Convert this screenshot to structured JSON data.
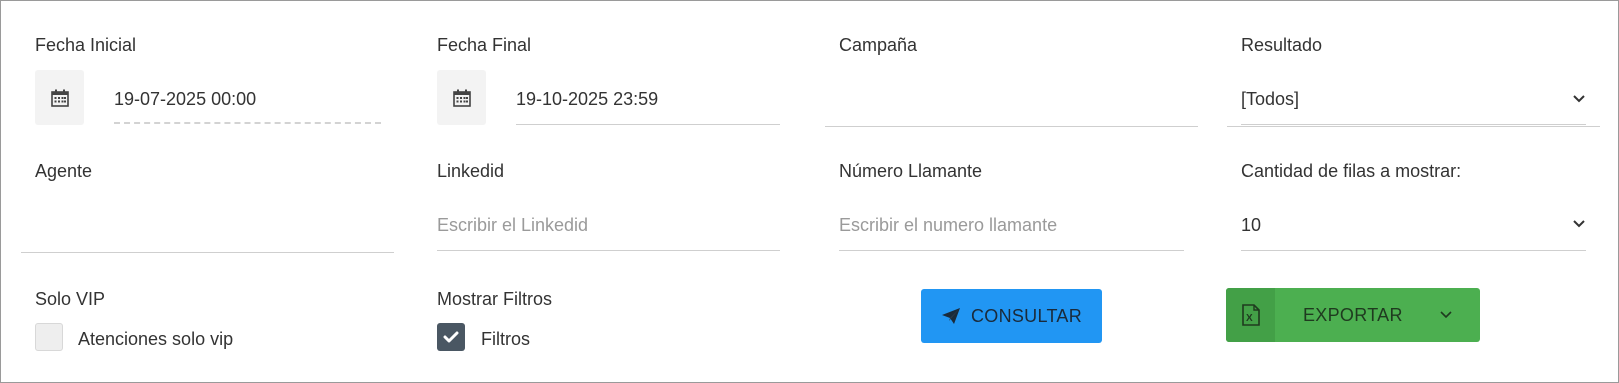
{
  "filters": {
    "fecha_inicial": {
      "label": "Fecha Inicial",
      "value": "19-07-2025 00:00"
    },
    "fecha_final": {
      "label": "Fecha Final",
      "value": "19-10-2025 23:59"
    },
    "campana": {
      "label": "Campaña",
      "value": ""
    },
    "resultado": {
      "label": "Resultado",
      "value": "[Todos]"
    },
    "agente": {
      "label": "Agente",
      "value": ""
    },
    "linkedid": {
      "label": "Linkedid",
      "placeholder": "Escribir el Linkedid"
    },
    "numero_llamante": {
      "label": "Número Llamante",
      "placeholder": "Escribir el numero llamante"
    },
    "cantidad_filas": {
      "label": "Cantidad de filas a mostrar:",
      "value": "10"
    },
    "solo_vip": {
      "label": "Solo VIP",
      "checkbox_label": "Atenciones solo vip",
      "checked": false
    },
    "mostrar_filtros": {
      "label": "Mostrar Filtros",
      "checkbox_label": "Filtros",
      "checked": true
    }
  },
  "actions": {
    "consultar_label": "CONSULTAR",
    "exportar_label": "EXPORTAR"
  },
  "icons": {
    "calendar": "calendar-icon",
    "chevron": "chevron-down-icon",
    "send": "paper-plane-icon",
    "excel": "excel-file-icon",
    "check": "check-icon"
  },
  "colors": {
    "primary": "#2196f3",
    "success": "#4caf50",
    "checkbox_checked": "#4a5763"
  }
}
